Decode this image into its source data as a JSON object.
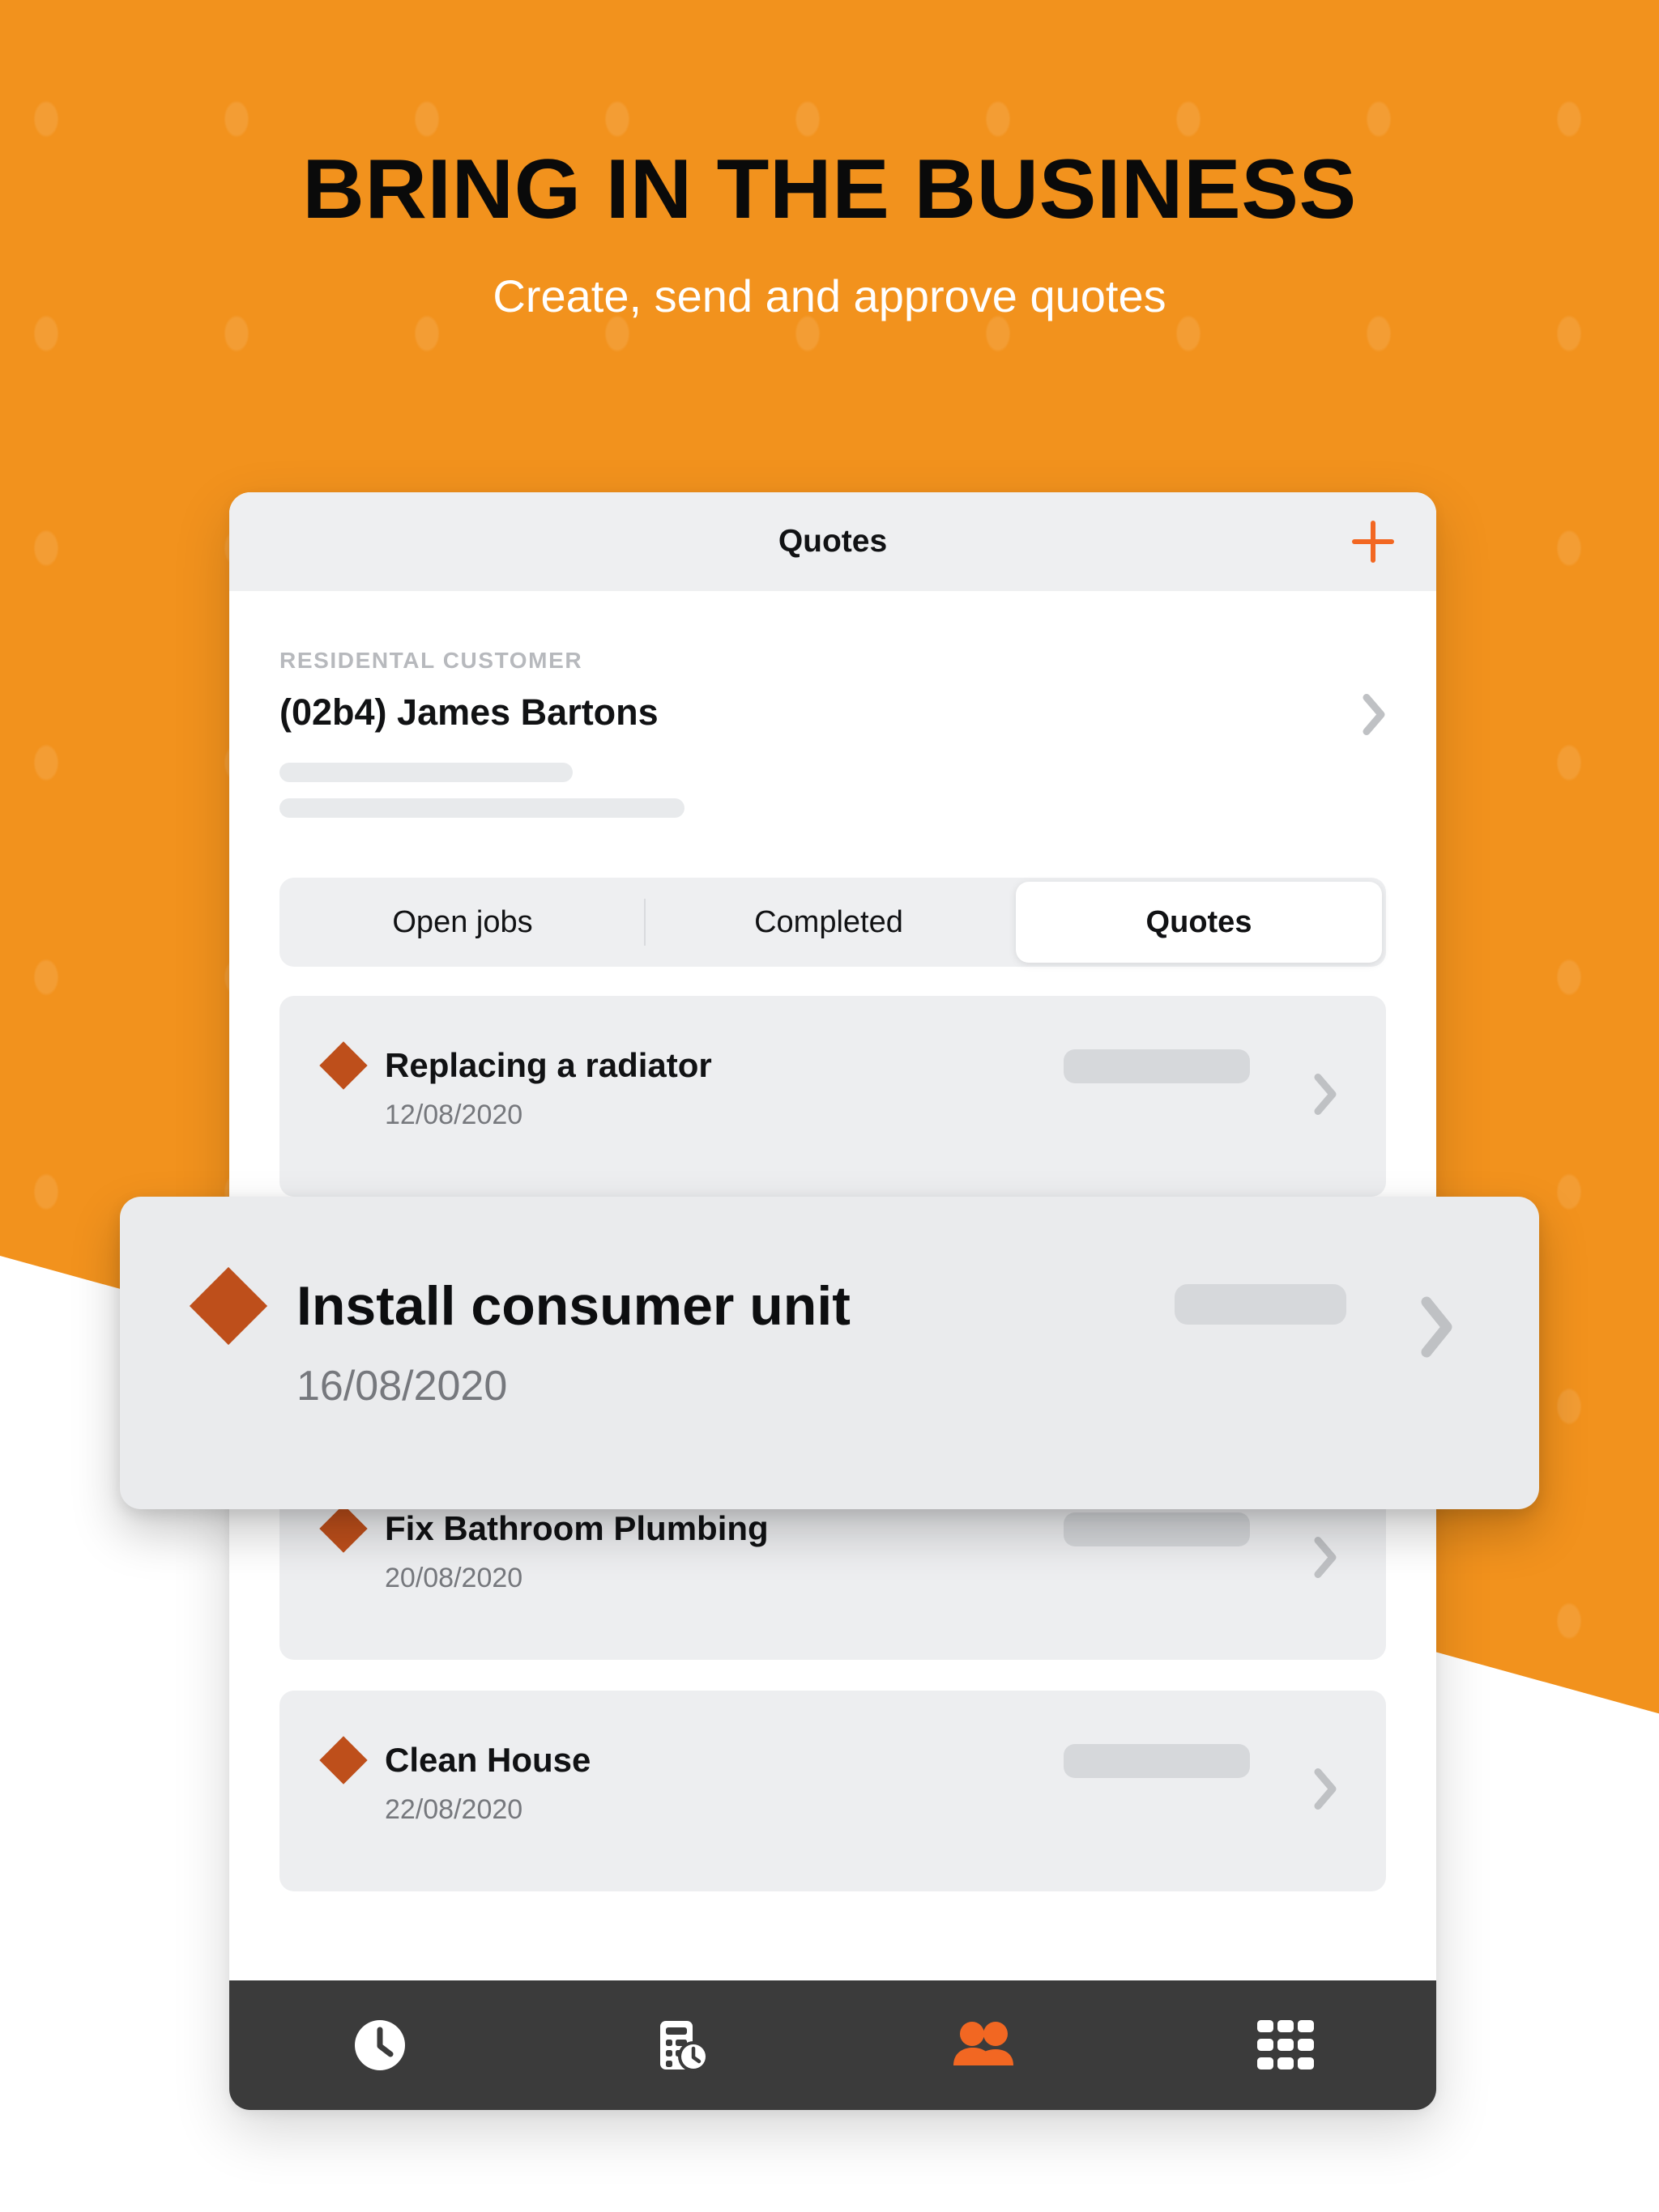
{
  "hero": {
    "title": "BRING IN THE BUSINESS",
    "subtitle": "Create, send and approve quotes"
  },
  "colors": {
    "background_orange": "#F2921D",
    "accent_orange": "#F26722",
    "diamond_rust": "#BE4F1B",
    "tabbar_dark": "#3B3B3B",
    "card_grey": "#EDEEF0",
    "topbar_grey": "#EEEFF1"
  },
  "phone": {
    "topbar": {
      "title": "Quotes",
      "add_icon": "plus-icon"
    },
    "customer": {
      "kicker": "RESIDENTAL CUSTOMER",
      "name": "(02b4) James Bartons",
      "chevron_icon": "chevron-right-icon",
      "skeleton_lines": 2
    },
    "segmented_control": {
      "options": [
        "Open jobs",
        "Completed",
        "Quotes"
      ],
      "selected": "Quotes"
    },
    "quotes": [
      {
        "title": "Replacing a radiator",
        "date": "12/08/2020",
        "status_icon": "diamond-icon",
        "chevron_icon": "chevron-right-icon"
      },
      {
        "title": "Install consumer unit",
        "date": "16/08/2020",
        "status_icon": "diamond-icon",
        "chevron_icon": "chevron-right-icon",
        "highlighted": true
      },
      {
        "title": "Fix Bathroom Plumbing",
        "date": "20/08/2020",
        "status_icon": "diamond-icon",
        "chevron_icon": "chevron-right-icon"
      },
      {
        "title": "Clean House",
        "date": "22/08/2020",
        "status_icon": "diamond-icon",
        "chevron_icon": "chevron-right-icon"
      }
    ],
    "tabbar": [
      {
        "name": "time",
        "icon": "clock-icon",
        "active": false
      },
      {
        "name": "invoices",
        "icon": "document-clock-icon",
        "active": false
      },
      {
        "name": "customers",
        "icon": "people-icon",
        "active": true
      },
      {
        "name": "more",
        "icon": "grid-icon",
        "active": false
      }
    ]
  }
}
